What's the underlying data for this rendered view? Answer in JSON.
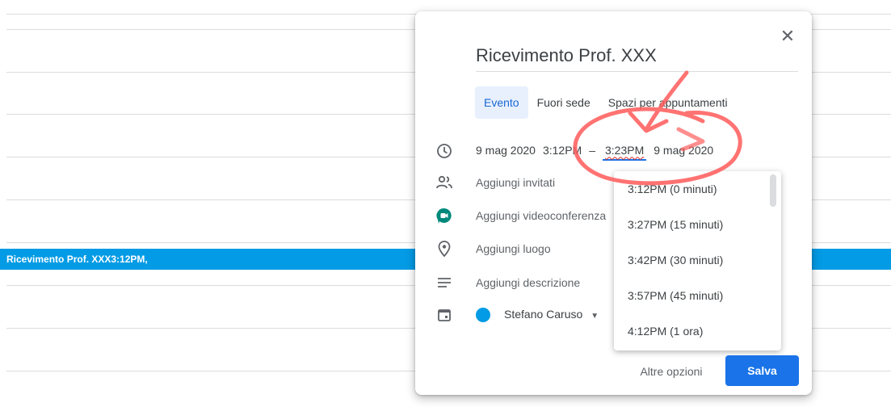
{
  "calendar_background": {
    "event_bar_label": "Ricevimento Prof. XXX3:12PM,"
  },
  "dialog": {
    "close_icon": "close-icon",
    "title_value": "Ricevimento Prof. XXX",
    "tabs": [
      {
        "label": "Evento",
        "active": true
      },
      {
        "label": "Fuori sede",
        "active": false
      },
      {
        "label": "Spazi per appuntamenti",
        "active": false
      }
    ],
    "datetime": {
      "start_date": "9 mag 2020",
      "start_time": "3:12PM",
      "separator": "–",
      "end_time": "3:23PM",
      "end_date": "9 mag 2020"
    },
    "rows": {
      "guests": "Aggiungi invitati",
      "video": "Aggiungi videoconferenza",
      "location": "Aggiungi luogo",
      "description": "Aggiungi descrizione",
      "calendar_owner": "Stefano Caruso"
    },
    "time_dropdown": {
      "options": [
        "3:12PM (0 minuti)",
        "3:27PM (15 minuti)",
        "3:42PM (30 minuti)",
        "3:57PM (45 minuti)",
        "4:12PM (1 ora)"
      ]
    },
    "footer": {
      "more_options": "Altre opzioni",
      "save": "Salva"
    }
  },
  "colors": {
    "accent": "#1a73e8",
    "event_bar": "#039be5",
    "annotation": "#ff5a5a"
  }
}
